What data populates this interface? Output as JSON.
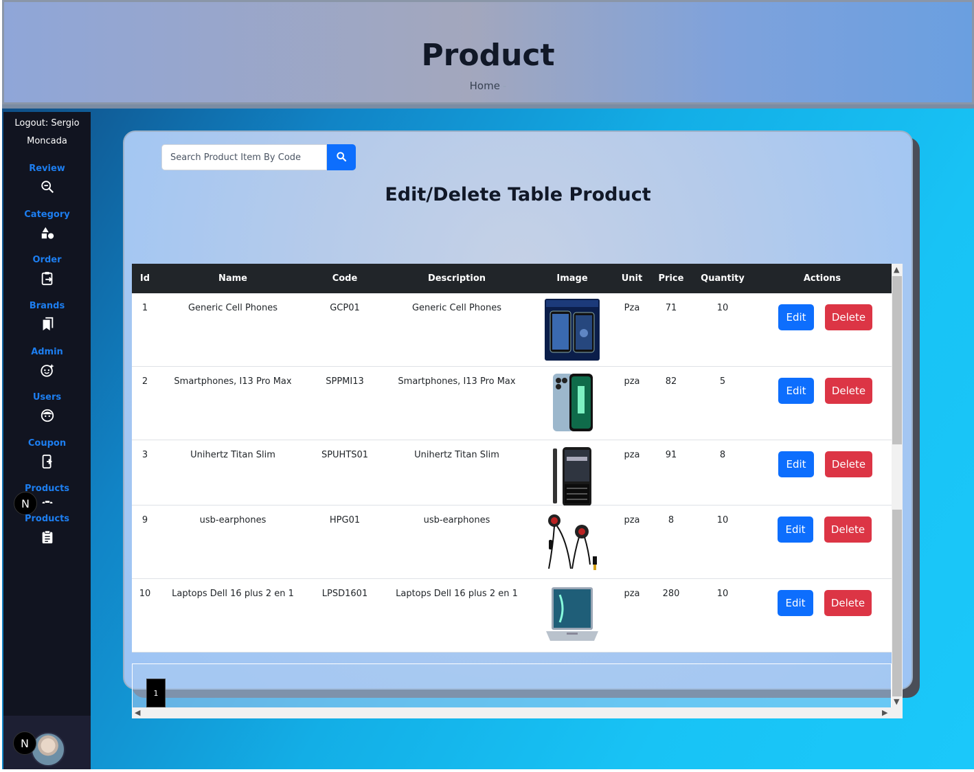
{
  "header": {
    "title": "Product",
    "breadcrumb_home": "Home",
    "breadcrumb_sep": "-"
  },
  "sidebar": {
    "logout_text": "Logout: Sergio Moncada",
    "items": [
      {
        "label": "Review",
        "icon": "search-minus-icon"
      },
      {
        "label": "Category",
        "icon": "shapes-icon"
      },
      {
        "label": "Order",
        "icon": "clipboard-arrow-icon"
      },
      {
        "label": "Brands",
        "icon": "bookmarks-icon"
      },
      {
        "label": "Admin",
        "icon": "face-smile-sparkle-icon"
      },
      {
        "label": "Users",
        "icon": "face-icon"
      },
      {
        "label": "Coupon",
        "icon": "phone-plus-icon"
      },
      {
        "label": "Products",
        "icon": "clipboard-list-icon"
      },
      {
        "label": "Products",
        "icon": "clipboard-list-icon"
      }
    ],
    "badge_letter": "N"
  },
  "search": {
    "placeholder": "Search Product Item By Code"
  },
  "card": {
    "title": "Edit/Delete Table Product"
  },
  "table": {
    "headers": [
      "Id",
      "Name",
      "Code",
      "Description",
      "Image",
      "Unit",
      "Price",
      "Quantity",
      "Actions"
    ],
    "rows": [
      {
        "id": "1",
        "name": "Generic Cell Phones",
        "code": "GCP01",
        "description": "Generic Cell Phones",
        "image": "phone-dark-image",
        "unit": "Pza",
        "price": "71",
        "quantity": "10"
      },
      {
        "id": "2",
        "name": "Smartphones, I13 Pro Max",
        "code": "SPPMI13",
        "description": "Smartphones, I13 Pro Max",
        "image": "phone-blue-image",
        "unit": "pza",
        "price": "82",
        "quantity": "5"
      },
      {
        "id": "3",
        "name": "Unihertz Titan Slim",
        "code": "SPUHTS01",
        "description": "Unihertz Titan Slim",
        "image": "phone-keyboard-image",
        "unit": "pza",
        "price": "91",
        "quantity": "8"
      },
      {
        "id": "9",
        "name": "usb-earphones",
        "code": "HPG01",
        "description": "usb-earphones",
        "image": "earphones-image",
        "unit": "pza",
        "price": "8",
        "quantity": "10"
      },
      {
        "id": "10",
        "name": "Laptops Dell 16 plus 2 en 1",
        "code": "LPSD1601",
        "description": "Laptops Dell 16 plus 2 en 1",
        "image": "laptop-image",
        "unit": "pza",
        "price": "280",
        "quantity": "10"
      }
    ],
    "edit_label": "Edit",
    "delete_label": "Delete"
  },
  "pagination": {
    "current_page": "1"
  },
  "colors": {
    "primary": "#0d6efd",
    "danger": "#dc3545",
    "sidebar_bg": "#111420",
    "nav_label": "#1d7ef0",
    "table_header": "#212529"
  }
}
